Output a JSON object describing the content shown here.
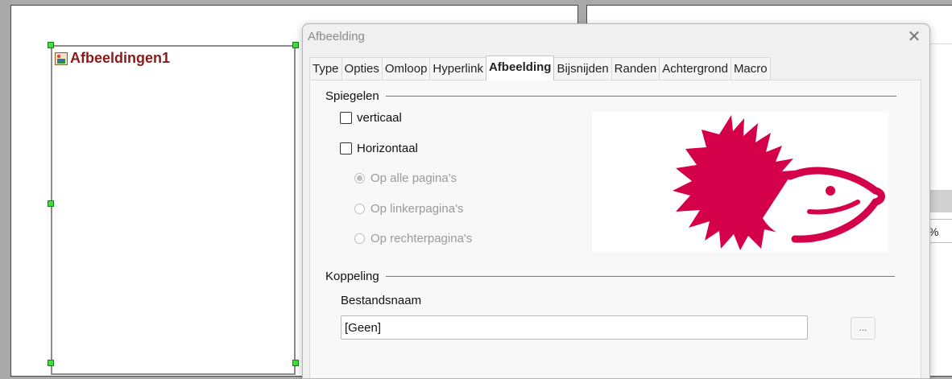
{
  "document": {
    "object_label": "Afbeeldingen1",
    "side_percent": "%"
  },
  "dialog": {
    "title": "Afbeelding",
    "close_icon": "close-icon",
    "tabs": [
      "Type",
      "Opties",
      "Omloop",
      "Hyperlink",
      "Afbeelding",
      "Bijsnijden",
      "Randen",
      "Achtergrond",
      "Macro"
    ],
    "active_tab": "Afbeelding",
    "mirror": {
      "heading": "Spiegelen",
      "vertical_label": "verticaal",
      "vertical_checked": false,
      "horizontal_label": "Horizontaal",
      "horizontal_checked": false,
      "options": [
        "Op alle pagina's",
        "Op linkerpagina's",
        "Op rechterpagina's"
      ],
      "selected_option": "Op alle pagina's"
    },
    "link": {
      "heading": "Koppeling",
      "filename_label": "Bestandsnaam",
      "filename_value": "[Geen]",
      "browse_label": "..."
    },
    "preview": {
      "image": "hedgehog-logo",
      "color": "#d4004a"
    }
  }
}
